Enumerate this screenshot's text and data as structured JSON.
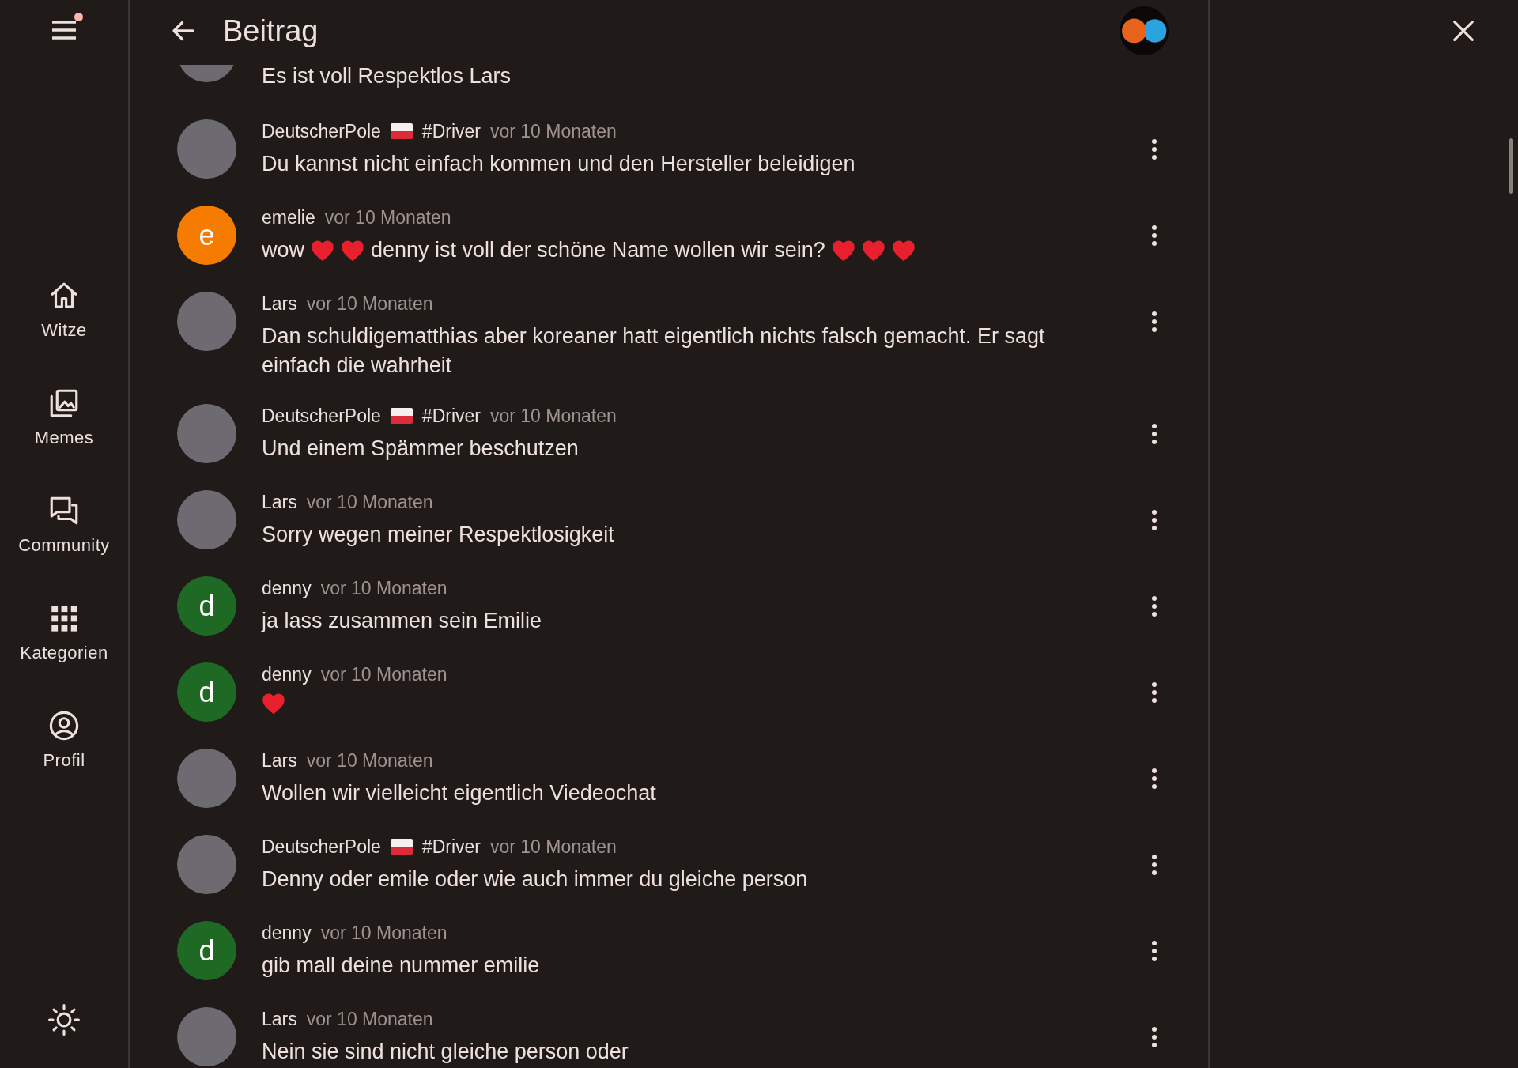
{
  "sidebar": {
    "menu_badge": true,
    "items": [
      {
        "label": "Witze",
        "kind": "home",
        "selected": false
      },
      {
        "label": "Memes",
        "kind": "images",
        "selected": false
      },
      {
        "label": "Community",
        "kind": "forum",
        "selected": false
      },
      {
        "label": "Kategorien",
        "kind": "apps",
        "selected": false
      },
      {
        "label": "Profil",
        "kind": "account",
        "selected": false
      }
    ]
  },
  "header": {
    "title": "Beitrag"
  },
  "comments": [
    {
      "kind": "cut",
      "avatar": {
        "kind": "photo"
      },
      "parts": [
        {
          "kind": "text",
          "text": "Es ist voll Respektlos Lars"
        }
      ]
    },
    {
      "kind": "full",
      "author": "DeutscherPole",
      "flag": true,
      "tag": "#Driver",
      "time": "vor 10 Monaten",
      "avatar": {
        "kind": "photo"
      },
      "parts": [
        {
          "kind": "text",
          "text": "Du kannst nicht einfach kommen und den Hersteller beleidigen"
        }
      ]
    },
    {
      "kind": "full",
      "author": "emelie",
      "time": "vor 10 Monaten",
      "avatar": {
        "kind": "letter",
        "letter": "e",
        "color": "#f57c00"
      },
      "parts": [
        {
          "kind": "text",
          "text": "wow"
        },
        {
          "kind": "heart"
        },
        {
          "kind": "heart"
        },
        {
          "kind": "text",
          "text": "denny ist voll der schöne Name wollen wir sein?"
        },
        {
          "kind": "heart"
        },
        {
          "kind": "heart"
        },
        {
          "kind": "heart"
        }
      ]
    },
    {
      "kind": "full",
      "author": "Lars",
      "time": "vor 10 Monaten",
      "avatar": {
        "kind": "photo"
      },
      "parts": [
        {
          "kind": "text",
          "text": "Dan schuldigematthias aber koreaner hatt eigentlich nichts falsch gemacht. Er sagt einfach die wahrheit"
        }
      ]
    },
    {
      "kind": "full",
      "author": "DeutscherPole",
      "flag": true,
      "tag": "#Driver",
      "time": "vor 10 Monaten",
      "avatar": {
        "kind": "photo"
      },
      "parts": [
        {
          "kind": "text",
          "text": "Und einem Spämmer beschutzen"
        }
      ]
    },
    {
      "kind": "full",
      "author": "Lars",
      "time": "vor 10 Monaten",
      "avatar": {
        "kind": "photo"
      },
      "parts": [
        {
          "kind": "text",
          "text": "Sorry wegen meiner Respektlosigkeit"
        }
      ]
    },
    {
      "kind": "full",
      "author": "denny",
      "time": "vor 10 Monaten",
      "avatar": {
        "kind": "letter",
        "letter": "d",
        "color": "#1e6a25"
      },
      "parts": [
        {
          "kind": "text",
          "text": "ja lass zusammen sein Emilie"
        }
      ]
    },
    {
      "kind": "full",
      "author": "denny",
      "time": "vor 10 Monaten",
      "avatar": {
        "kind": "letter",
        "letter": "d",
        "color": "#1e6a25"
      },
      "parts": [
        {
          "kind": "heart"
        }
      ]
    },
    {
      "kind": "full",
      "author": "Lars",
      "time": "vor 10 Monaten",
      "avatar": {
        "kind": "photo"
      },
      "parts": [
        {
          "kind": "text",
          "text": "Wollen wir vielleicht eigentlich Viedeochat"
        }
      ]
    },
    {
      "kind": "full",
      "author": "DeutscherPole",
      "flag": true,
      "tag": "#Driver",
      "time": "vor 10 Monaten",
      "avatar": {
        "kind": "photo"
      },
      "parts": [
        {
          "kind": "text",
          "text": "Denny oder emile oder wie auch immer du gleiche person"
        }
      ]
    },
    {
      "kind": "full",
      "author": "denny",
      "time": "vor 10 Monaten",
      "avatar": {
        "kind": "letter",
        "letter": "d",
        "color": "#1e6a25"
      },
      "parts": [
        {
          "kind": "text",
          "text": "gib mall deine nummer emilie"
        }
      ]
    },
    {
      "kind": "full",
      "author": "Lars",
      "time": "vor 10 Monaten",
      "avatar": {
        "kind": "photo"
      },
      "parts": [
        {
          "kind": "text",
          "text": "Nein sie sind nicht gleiche person oder"
        }
      ]
    }
  ]
}
